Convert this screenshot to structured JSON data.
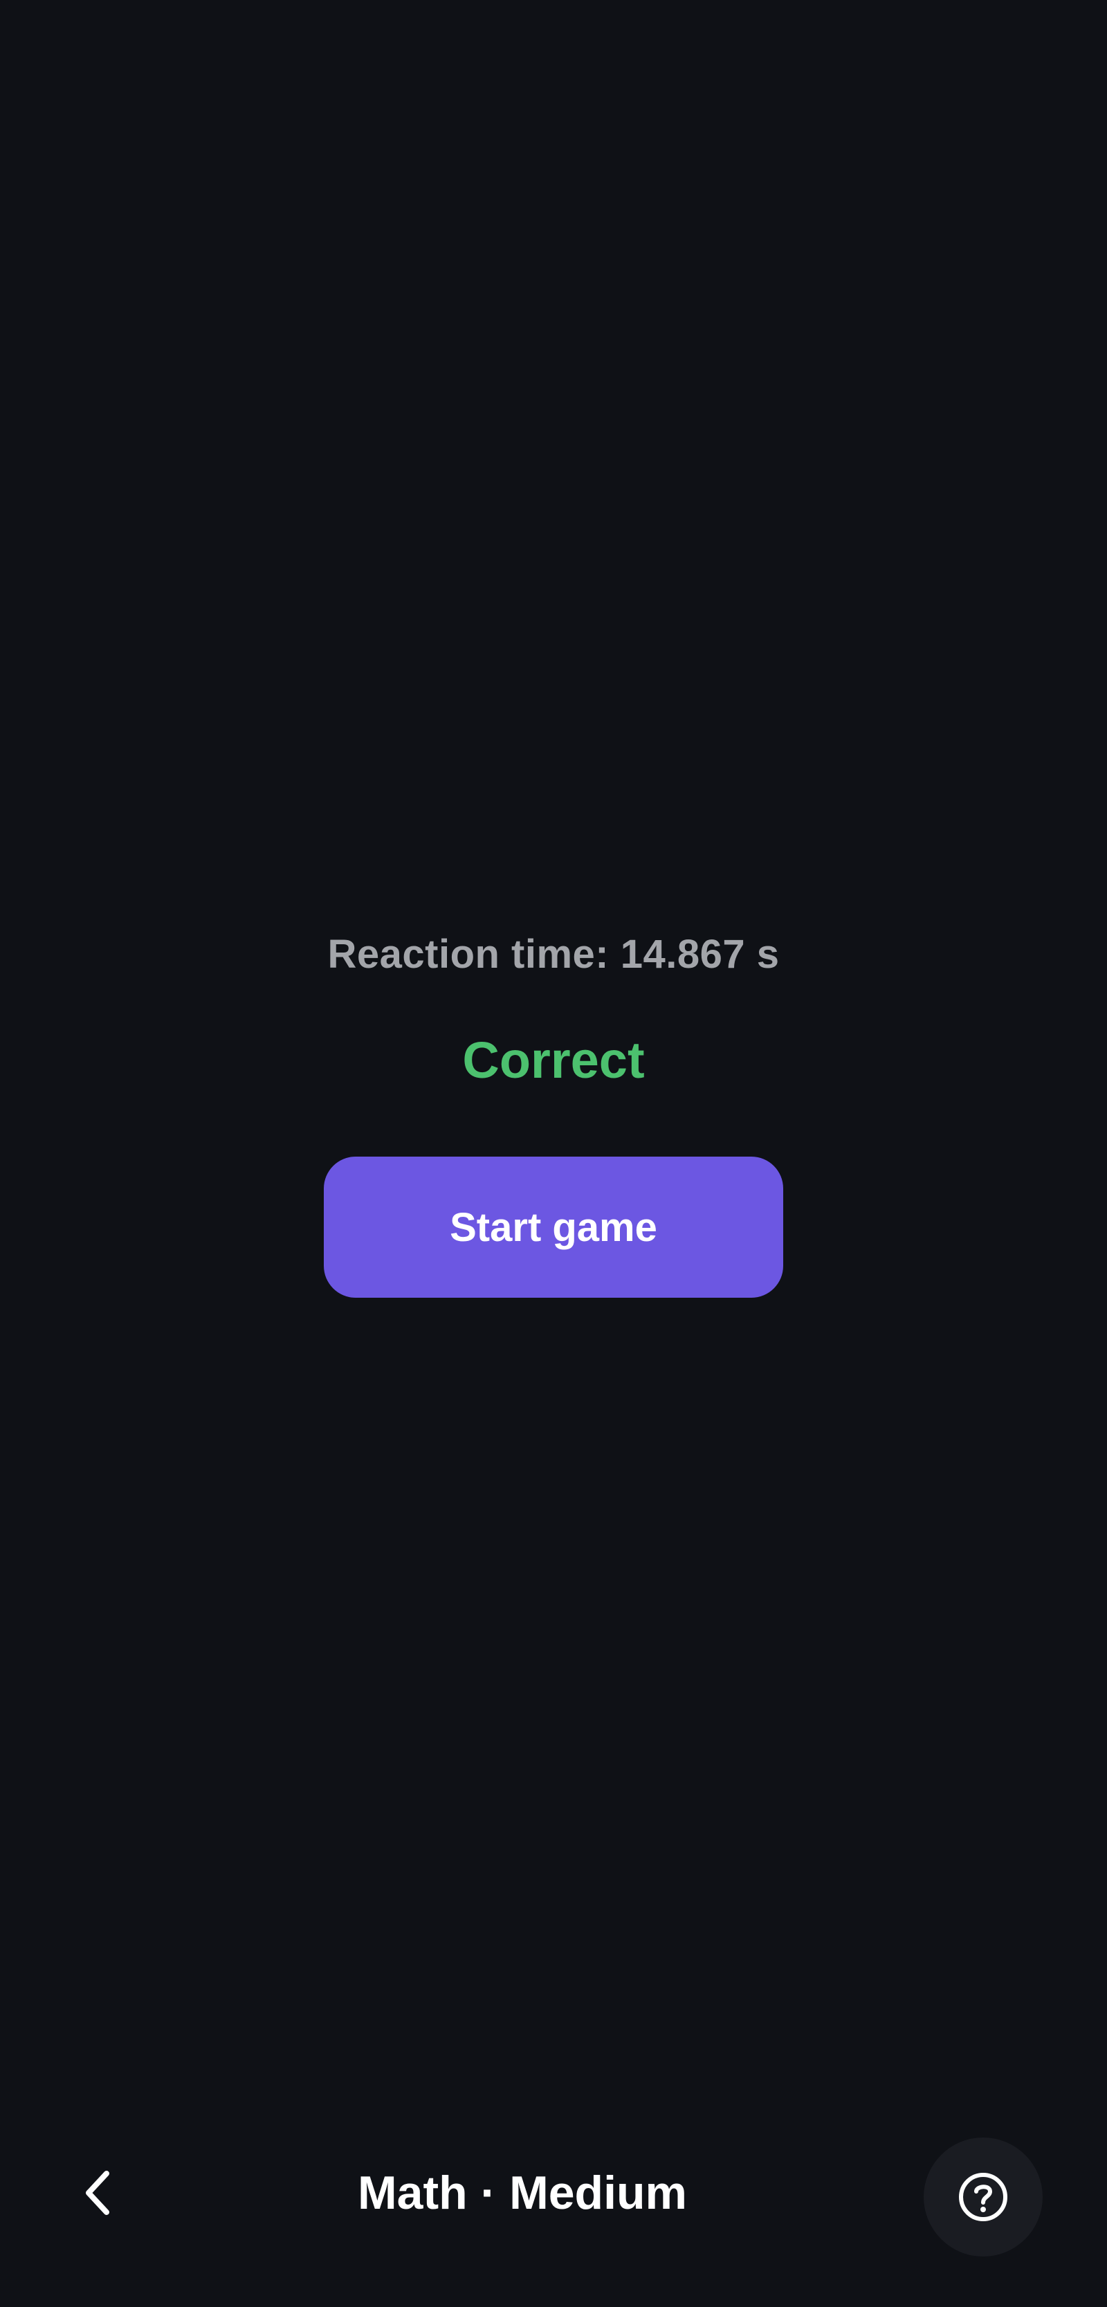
{
  "result": {
    "reaction_time_text": "Reaction time: 14.867 s",
    "status_text": "Correct",
    "status_color": "#4cc16e"
  },
  "actions": {
    "start_label": "Start game",
    "start_color": "#6c57e2"
  },
  "bottom_bar": {
    "title": "Math · Medium",
    "back_icon": "chevron-left-icon",
    "help_icon": "help-circle-icon"
  },
  "theme": {
    "background": "#0f1116",
    "text_secondary": "#a3a5aa",
    "text_primary": "#ffffff"
  }
}
